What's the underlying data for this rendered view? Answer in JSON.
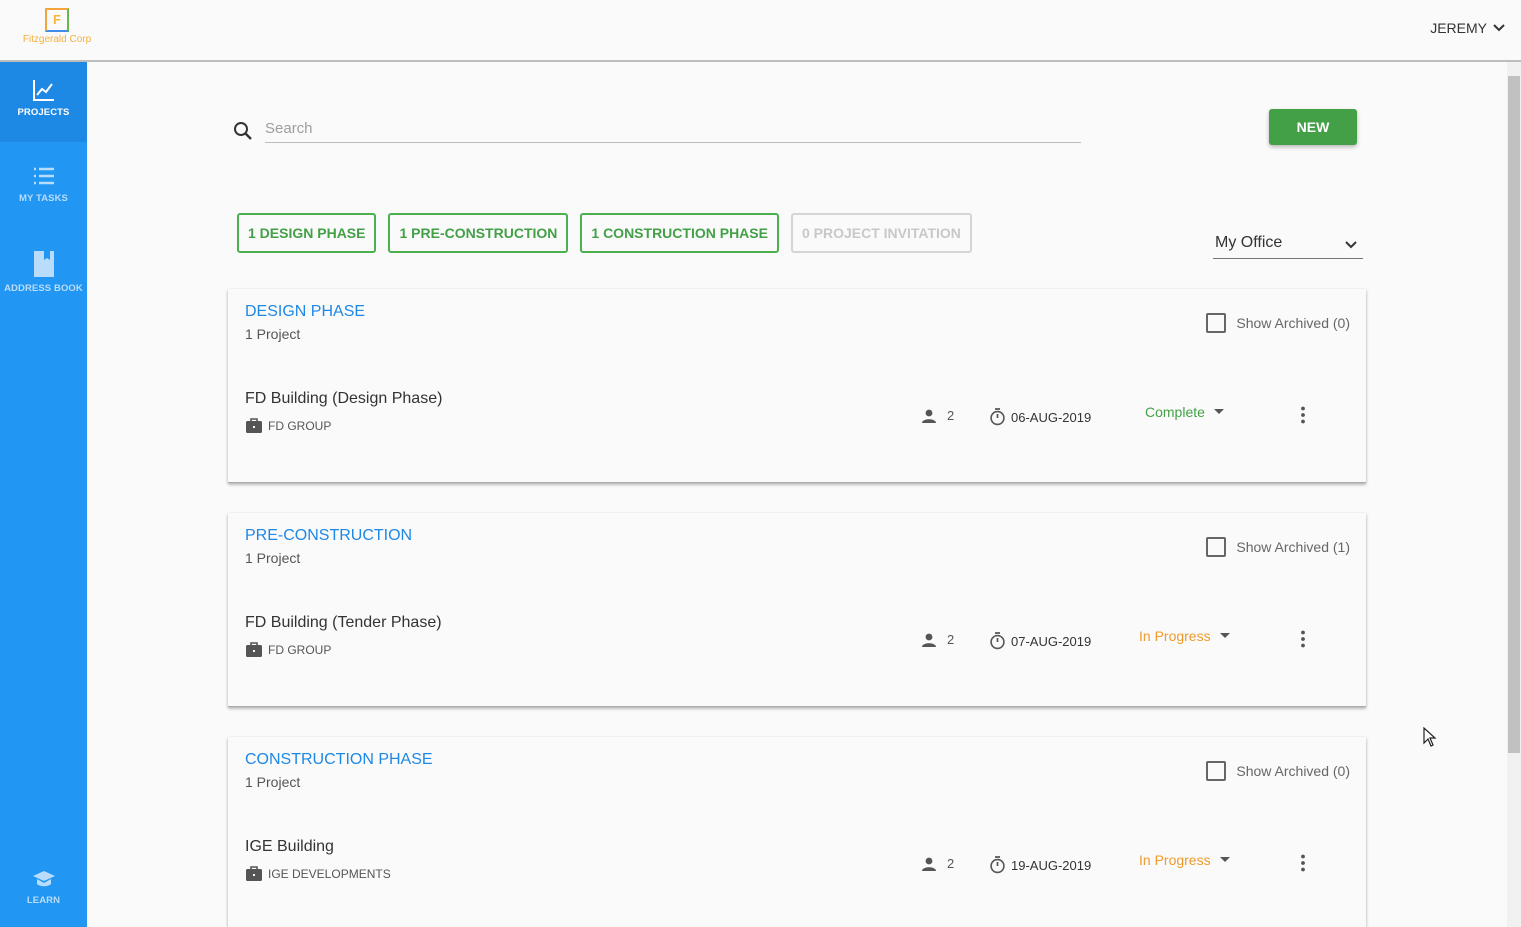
{
  "brand": {
    "mark": "F",
    "name": "Fitzgerald Corp"
  },
  "user": {
    "name": "JEREMY"
  },
  "sidebar": {
    "items": [
      {
        "label": "PROJECTS",
        "icon": "chart-line-icon",
        "active": true
      },
      {
        "label": "MY TASKS",
        "icon": "list-icon",
        "active": false
      },
      {
        "label": "ADDRESS BOOK",
        "icon": "book-icon",
        "active": false
      },
      {
        "label": "LEARN",
        "icon": "graduation-cap-icon",
        "active": false
      }
    ]
  },
  "search": {
    "placeholder": "Search",
    "value": ""
  },
  "toolbar": {
    "new_label": "NEW"
  },
  "filters": [
    {
      "label": "1 DESIGN PHASE",
      "enabled": true
    },
    {
      "label": "1 PRE-CONSTRUCTION",
      "enabled": true
    },
    {
      "label": "1 CONSTRUCTION PHASE",
      "enabled": true
    },
    {
      "label": "0 PROJECT INVITATION",
      "enabled": false
    }
  ],
  "office_select": {
    "selected": "My Office"
  },
  "sections": [
    {
      "title": "DESIGN PHASE",
      "count_label": "1 Project",
      "archive_label": "Show Archived (0)",
      "project": {
        "name": "FD Building (Design Phase)",
        "company": "FD GROUP",
        "members": "2",
        "date": "06-AUG-2019",
        "status": "Complete",
        "status_color": "#43a047"
      }
    },
    {
      "title": "PRE-CONSTRUCTION",
      "count_label": "1 Project",
      "archive_label": "Show Archived (1)",
      "project": {
        "name": "FD Building (Tender Phase)",
        "company": "FD GROUP",
        "members": "2",
        "date": "07-AUG-2019",
        "status": "In Progress",
        "status_color": "#ef9a2b"
      }
    },
    {
      "title": "CONSTRUCTION PHASE",
      "count_label": "1 Project",
      "archive_label": "Show Archived (0)",
      "project": {
        "name": "IGE Building",
        "company": "IGE DEVELOPMENTS",
        "members": "2",
        "date": "19-AUG-2019",
        "status": "In Progress",
        "status_color": "#ef9a2b"
      }
    }
  ],
  "colors": {
    "primary": "#2196f3",
    "accent": "#43a047",
    "warning": "#ef9a2b",
    "link": "#1e88e5"
  }
}
